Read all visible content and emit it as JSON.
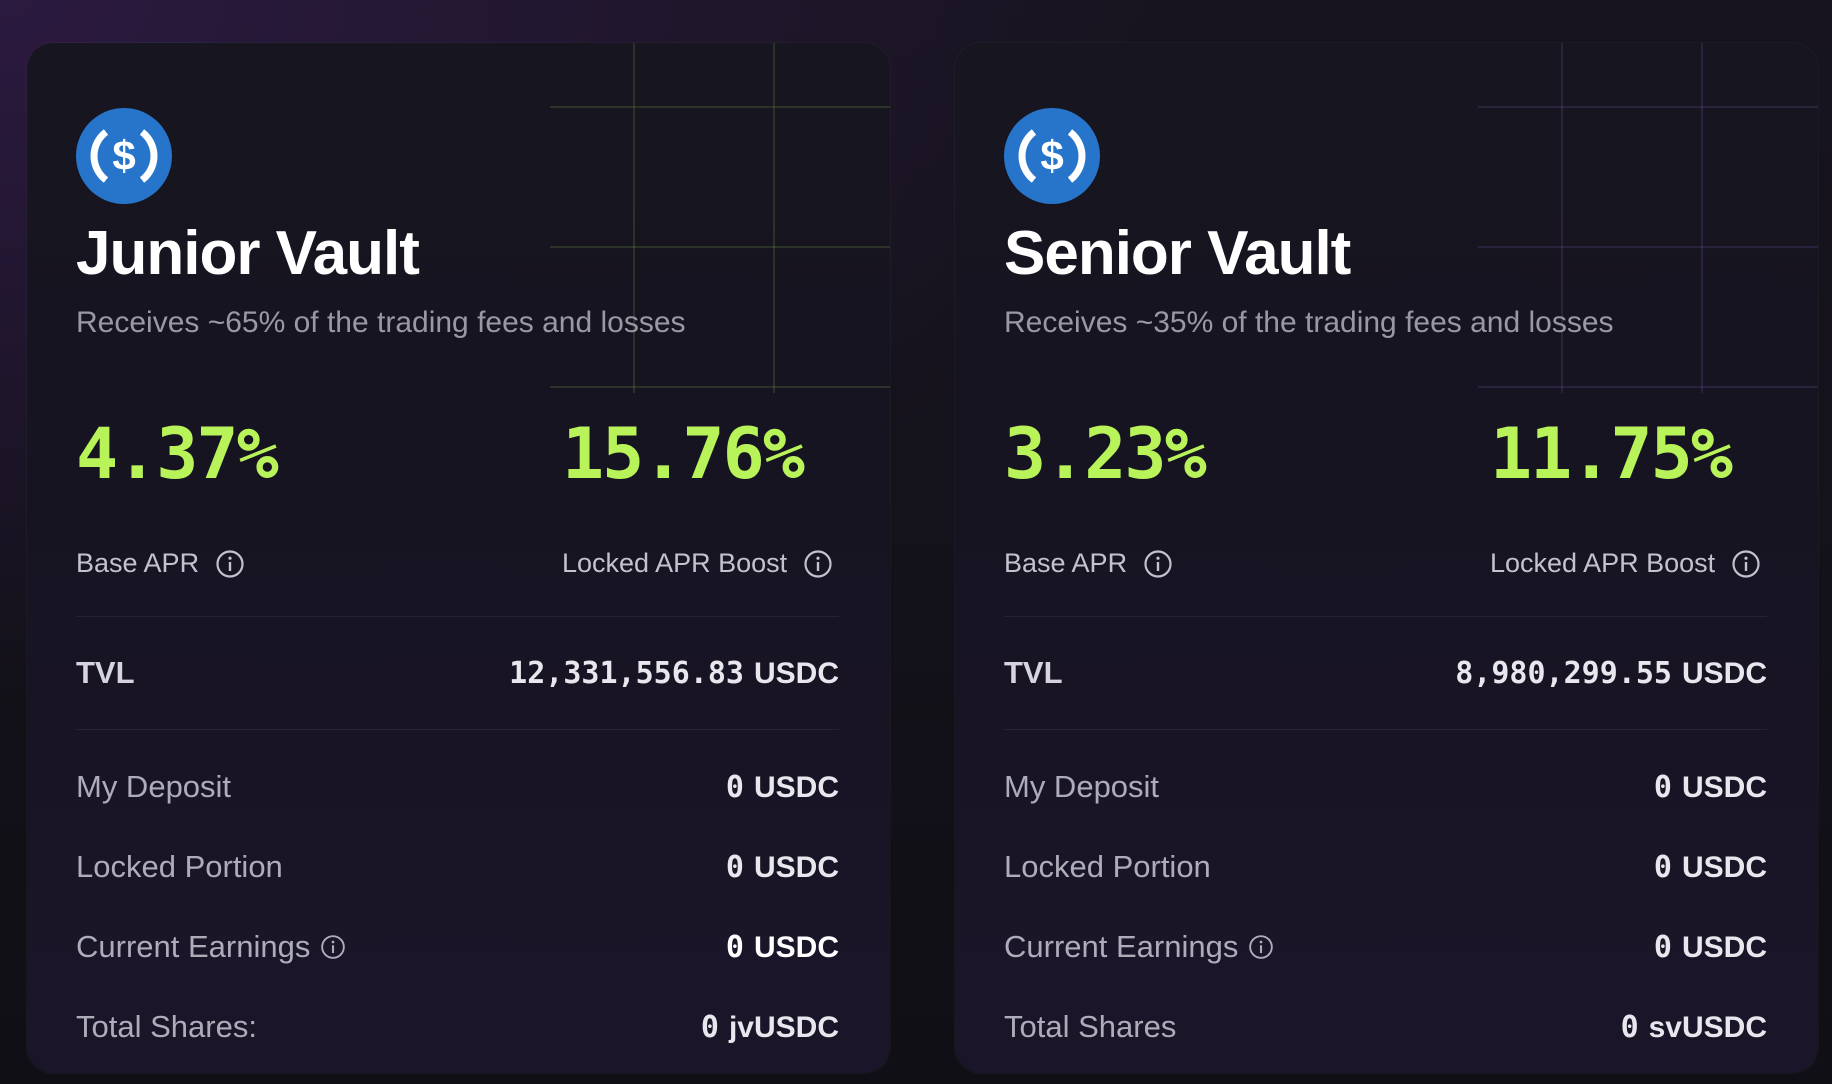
{
  "colors": {
    "accent_green": "#b9f35a",
    "usdc_blue": "#2775ca",
    "background": "#12111a",
    "card": "#17151f"
  },
  "vaults": [
    {
      "icon": "usdc-coin-icon",
      "title": "Junior Vault",
      "subtitle": "Receives ~65% of the trading fees and losses",
      "base_apr_value": "4.37%",
      "base_apr_label": "Base APR",
      "boost_value": "15.76%",
      "boost_label": "Locked APR Boost",
      "tvl_label": "TVL",
      "tvl_amount": "12,331,556.83",
      "tvl_unit": "USDC",
      "my_deposit_label": "My Deposit",
      "my_deposit_amount": "0",
      "my_deposit_unit": "USDC",
      "locked_label": "Locked Portion",
      "locked_amount": "0",
      "locked_unit": "USDC",
      "earnings_label": "Current Earnings",
      "earnings_amount": "0",
      "earnings_unit": "USDC",
      "shares_label": "Total Shares:",
      "shares_amount": "0",
      "shares_unit": "jvUSDC"
    },
    {
      "icon": "usdc-coin-icon",
      "title": "Senior Vault",
      "subtitle": "Receives ~35% of the trading fees and losses",
      "base_apr_value": "3.23%",
      "base_apr_label": "Base APR",
      "boost_value": "11.75%",
      "boost_label": "Locked APR Boost",
      "tvl_label": "TVL",
      "tvl_amount": "8,980,299.55",
      "tvl_unit": "USDC",
      "my_deposit_label": "My Deposit",
      "my_deposit_amount": "0",
      "my_deposit_unit": "USDC",
      "locked_label": "Locked Portion",
      "locked_amount": "0",
      "locked_unit": "USDC",
      "earnings_label": "Current Earnings",
      "earnings_amount": "0",
      "earnings_unit": "USDC",
      "shares_label": "Total Shares",
      "shares_amount": "0",
      "shares_unit": "svUSDC"
    }
  ]
}
